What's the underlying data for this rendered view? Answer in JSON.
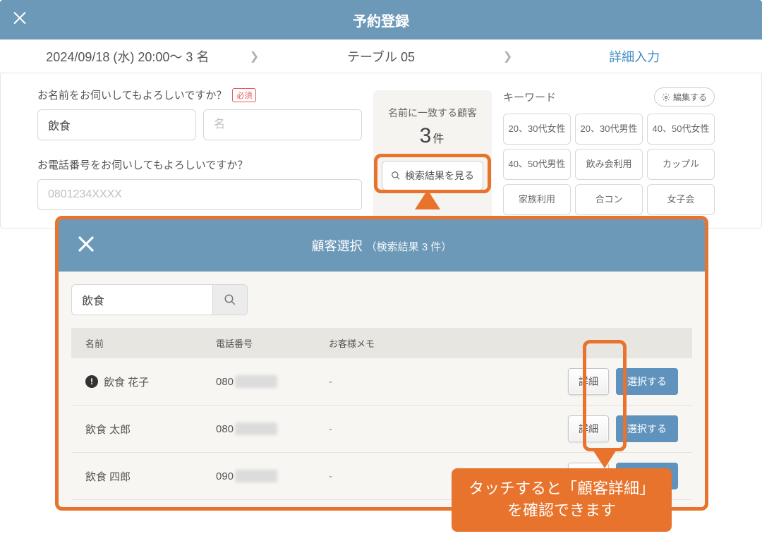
{
  "header": {
    "title": "予約登録"
  },
  "breadcrumb": {
    "step1": "2024/09/18 (水) 20:00～ 3 名",
    "step2": "テーブル 05",
    "step3": "詳細入力"
  },
  "form": {
    "name_label": "お名前をお伺いしてもよろしいですか？",
    "required_badge": "必須",
    "last_name_value": "飲食",
    "first_name_placeholder": "名",
    "phone_label": "お電話番号をお伺いしてもよろしいですか？",
    "phone_placeholder": "0801234XXXX"
  },
  "match": {
    "label": "名前に一致する顧客",
    "count": "3",
    "unit": "件",
    "view_button": "検索結果を見る"
  },
  "keywords": {
    "title": "キーワード",
    "edit": "編集する",
    "items": [
      "20、30代女性",
      "20、30代男性",
      "40、50代女性",
      "40、50代男性",
      "飲み会利用",
      "カップル",
      "家族利用",
      "合コン",
      "女子会"
    ]
  },
  "modal": {
    "title": "顧客選択",
    "subtitle": "（検索結果 3 件）",
    "search_value": "飲食",
    "columns": {
      "name": "名前",
      "phone": "電話番号",
      "memo": "お客様メモ"
    },
    "detail_btn": "詳細",
    "select_btn": "選択する",
    "rows": [
      {
        "alert": true,
        "name": "飲食 花子",
        "phone_prefix": "080",
        "memo": "-"
      },
      {
        "alert": false,
        "name": "飲食 太郎",
        "phone_prefix": "080",
        "memo": "-"
      },
      {
        "alert": false,
        "name": "飲食 四郎",
        "phone_prefix": "090",
        "memo": "-"
      }
    ]
  },
  "tooltip": {
    "line1": "タッチすると「顧客詳細」",
    "line2": "を確認できます"
  }
}
